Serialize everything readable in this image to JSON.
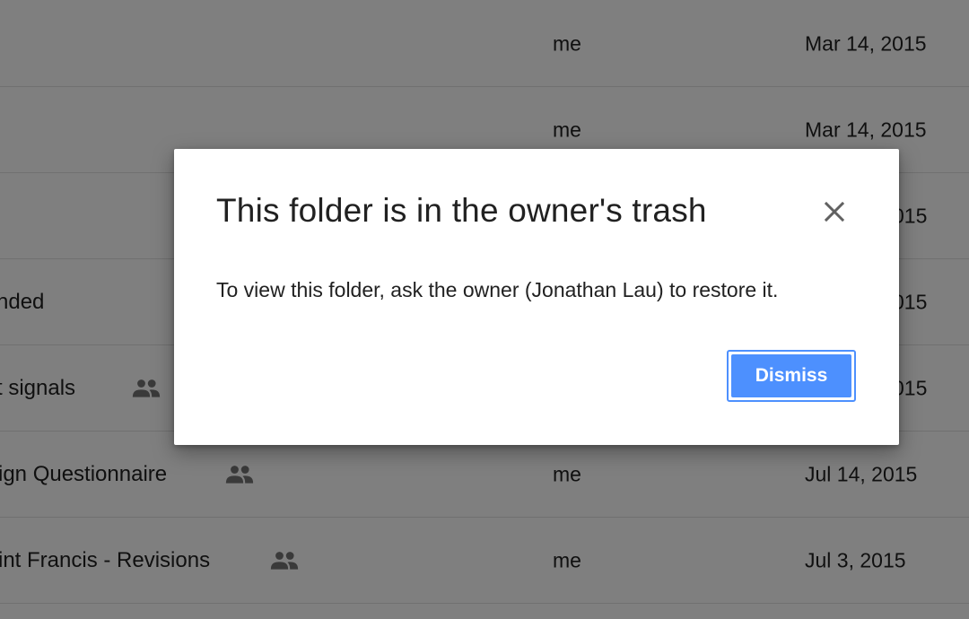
{
  "file_list": {
    "rows": [
      {
        "name": "",
        "shared": false,
        "owner": "me",
        "modified": "Mar 14, 2015"
      },
      {
        "name": "",
        "shared": false,
        "owner": "me",
        "modified": "Mar 14, 2015"
      },
      {
        "name": "",
        "shared": false,
        "owner": "",
        "modified": "015"
      },
      {
        "name": "nded",
        "shared": false,
        "owner": "",
        "modified": "015"
      },
      {
        "name": "t signals",
        "shared": true,
        "owner": "",
        "modified": "015"
      },
      {
        "name": "ign Questionnaire",
        "shared": true,
        "owner": "me",
        "modified": "Jul 14, 2015"
      },
      {
        "name": "int Francis - Revisions",
        "shared": true,
        "owner": "me",
        "modified": "Jul 3, 2015"
      }
    ],
    "shared_icon": "people-icon"
  },
  "dialog": {
    "title": "This folder is in the owner's trash",
    "close_icon": "close-icon",
    "message": "To view this folder, ask the owner (Jonathan Lau) to restore it.",
    "dismiss_label": "Dismiss",
    "accent_color": "#4d90fe",
    "scrim_color": "rgba(0,0,0,0.5)"
  }
}
